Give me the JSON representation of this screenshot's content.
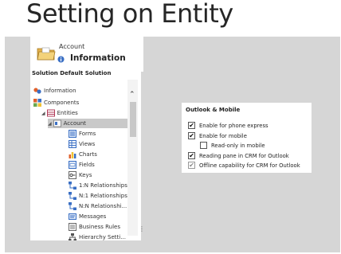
{
  "slide": {
    "title": "Setting on Entity"
  },
  "header": {
    "entity": "Account",
    "section": "Information"
  },
  "nav": {
    "title": "Solution Default Solution",
    "items": [
      {
        "label": "Information",
        "icon": "info-icon"
      },
      {
        "label": "Components",
        "icon": "components-icon",
        "expander": "◢"
      },
      {
        "label": "Entities",
        "icon": "entities-icon",
        "expander": "◢"
      },
      {
        "label": "Account",
        "icon": "account-icon",
        "expander": "◢"
      },
      {
        "label": "Forms",
        "icon": "forms-icon"
      },
      {
        "label": "Views",
        "icon": "views-icon"
      },
      {
        "label": "Charts",
        "icon": "charts-icon"
      },
      {
        "label": "Fields",
        "icon": "fields-icon"
      },
      {
        "label": "Keys",
        "icon": "keys-icon"
      },
      {
        "label": "1:N Relationships",
        "icon": "relationship-icon"
      },
      {
        "label": "N:1 Relationships",
        "icon": "relationship-icon"
      },
      {
        "label": "N:N Relationshi...",
        "icon": "relationship-icon"
      },
      {
        "label": "Messages",
        "icon": "messages-icon"
      },
      {
        "label": "Business Rules",
        "icon": "business-rules-icon"
      },
      {
        "label": "Hierarchy Setti...",
        "icon": "hierarchy-icon"
      }
    ]
  },
  "panel": {
    "title": "Outlook & Mobile",
    "options": [
      {
        "label": "Enable for phone express",
        "checked": true,
        "enabled": true
      },
      {
        "label": "Enable for mobile",
        "checked": true,
        "enabled": true
      },
      {
        "label": "Read-only in mobile",
        "checked": false,
        "enabled": true
      },
      {
        "label": "Reading pane in CRM for Outlook",
        "checked": true,
        "enabled": true
      },
      {
        "label": "Offline capability for CRM for Outlook",
        "checked": true,
        "enabled": false
      }
    ]
  },
  "glyphs": {
    "check": "✔",
    "scroll_up": "⌃",
    "splitter": "⋮"
  },
  "colors": {
    "frame": "#d6d6d6",
    "selected": "#c9c9c9",
    "accent_blue": "#3a6fc4"
  }
}
